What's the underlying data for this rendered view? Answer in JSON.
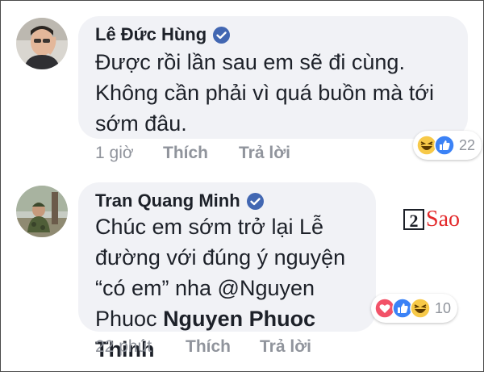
{
  "comments": [
    {
      "author": "Lê Đức Hùng",
      "verified": true,
      "text_lines": [
        "Được rồi lần sau em sẽ đi cùng.",
        "Không cần phải vì quá buồn mà tới",
        "sớm đâu."
      ],
      "time": "1 giờ",
      "like_label": "Thích",
      "reply_label": "Trả lời",
      "reactions": [
        "haha-icon",
        "like-icon"
      ],
      "reaction_count": "22"
    },
    {
      "author": "Tran Quang Minh",
      "verified": true,
      "text_lines": [
        "Chúc em sớm trở lại Lễ",
        "đường với đúng ý nguyện",
        "“có em” nha @Nguyen"
      ],
      "last_line_plain": "Phuoc ",
      "mention": "Nguyen Phuoc Thinh",
      "time": "22 phút",
      "like_label": "Thích",
      "reply_label": "Trả lời",
      "reactions": [
        "love-icon",
        "like-icon",
        "haha-icon"
      ],
      "reaction_count": "10"
    }
  ],
  "watermark": {
    "digit": "2",
    "word": "Sao"
  },
  "colors": {
    "bubble": "#f1f2f6",
    "text": "#1d2129",
    "meta": "#90949c",
    "verified": "#4267b2",
    "like": "#3b82f6",
    "love": "#f25268",
    "haha": "#f7c948",
    "watermark_red": "#e3292b"
  }
}
